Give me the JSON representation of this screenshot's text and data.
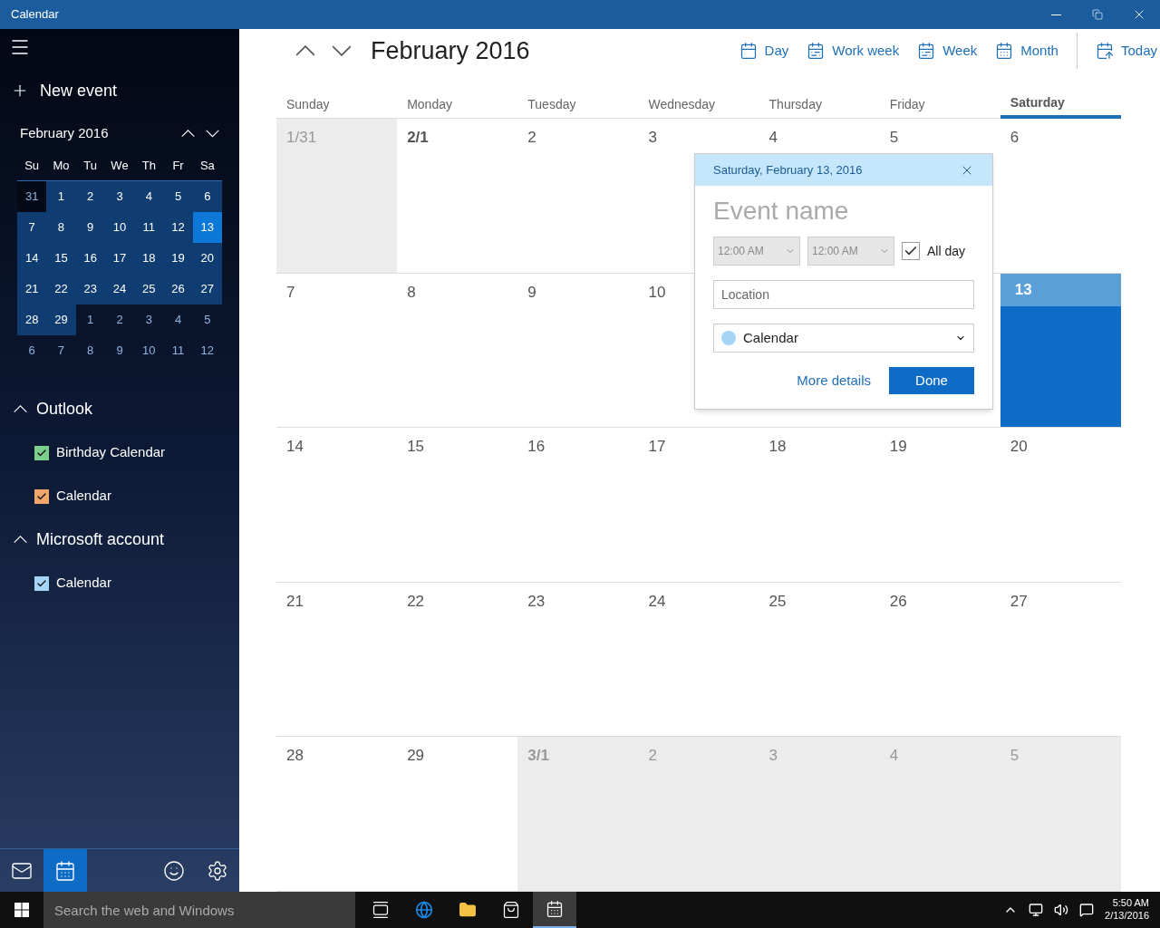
{
  "window": {
    "title": "Calendar"
  },
  "sidebar": {
    "new_event": "New event",
    "mini_calendar": {
      "title": "February 2016",
      "weekdays": [
        "Su",
        "Mo",
        "Tu",
        "We",
        "Th",
        "Fr",
        "Sa"
      ],
      "weeks": [
        [
          {
            "label": "31",
            "in_month": false,
            "selected": false
          },
          {
            "label": "1",
            "in_month": true,
            "selected": false
          },
          {
            "label": "2",
            "in_month": true,
            "selected": false
          },
          {
            "label": "3",
            "in_month": true,
            "selected": false
          },
          {
            "label": "4",
            "in_month": true,
            "selected": false
          },
          {
            "label": "5",
            "in_month": true,
            "selected": false
          },
          {
            "label": "6",
            "in_month": true,
            "selected": false
          }
        ],
        [
          {
            "label": "7",
            "in_month": true,
            "selected": false
          },
          {
            "label": "8",
            "in_month": true,
            "selected": false
          },
          {
            "label": "9",
            "in_month": true,
            "selected": false
          },
          {
            "label": "10",
            "in_month": true,
            "selected": false
          },
          {
            "label": "11",
            "in_month": true,
            "selected": false
          },
          {
            "label": "12",
            "in_month": true,
            "selected": false
          },
          {
            "label": "13",
            "in_month": true,
            "selected": true
          }
        ],
        [
          {
            "label": "14",
            "in_month": true,
            "selected": false
          },
          {
            "label": "15",
            "in_month": true,
            "selected": false
          },
          {
            "label": "16",
            "in_month": true,
            "selected": false
          },
          {
            "label": "17",
            "in_month": true,
            "selected": false
          },
          {
            "label": "18",
            "in_month": true,
            "selected": false
          },
          {
            "label": "19",
            "in_month": true,
            "selected": false
          },
          {
            "label": "20",
            "in_month": true,
            "selected": false
          }
        ],
        [
          {
            "label": "21",
            "in_month": true,
            "selected": false
          },
          {
            "label": "22",
            "in_month": true,
            "selected": false
          },
          {
            "label": "23",
            "in_month": true,
            "selected": false
          },
          {
            "label": "24",
            "in_month": true,
            "selected": false
          },
          {
            "label": "25",
            "in_month": true,
            "selected": false
          },
          {
            "label": "26",
            "in_month": true,
            "selected": false
          },
          {
            "label": "27",
            "in_month": true,
            "selected": false
          }
        ],
        [
          {
            "label": "28",
            "in_month": true,
            "selected": false
          },
          {
            "label": "29",
            "in_month": true,
            "selected": false
          },
          {
            "label": "1",
            "in_month": false,
            "selected": false
          },
          {
            "label": "2",
            "in_month": false,
            "selected": false
          },
          {
            "label": "3",
            "in_month": false,
            "selected": false
          },
          {
            "label": "4",
            "in_month": false,
            "selected": false
          },
          {
            "label": "5",
            "in_month": false,
            "selected": false
          }
        ],
        [
          {
            "label": "6",
            "in_month": false,
            "selected": false
          },
          {
            "label": "7",
            "in_month": false,
            "selected": false
          },
          {
            "label": "8",
            "in_month": false,
            "selected": false
          },
          {
            "label": "9",
            "in_month": false,
            "selected": false
          },
          {
            "label": "10",
            "in_month": false,
            "selected": false
          },
          {
            "label": "11",
            "in_month": false,
            "selected": false
          },
          {
            "label": "12",
            "in_month": false,
            "selected": false
          }
        ]
      ]
    },
    "groups": [
      {
        "name": "Outlook",
        "expanded": true,
        "calendars": [
          {
            "name": "Birthday Calendar",
            "checked": true,
            "color": "#7ccf8a"
          },
          {
            "name": "Calendar",
            "checked": true,
            "color": "#f0a56a"
          }
        ]
      },
      {
        "name": "Microsoft account",
        "expanded": true,
        "calendars": [
          {
            "name": "Calendar",
            "checked": true,
            "color": "#a6d4f7"
          }
        ]
      }
    ],
    "nav": [
      {
        "kind": "mail",
        "selected": false
      },
      {
        "kind": "calendar",
        "selected": true
      },
      {
        "kind": "feedback",
        "selected": false
      },
      {
        "kind": "settings",
        "selected": false
      }
    ]
  },
  "header": {
    "title": "February 2016",
    "views": [
      {
        "kind": "day",
        "label": "Day"
      },
      {
        "kind": "workweek",
        "label": "Work week"
      },
      {
        "kind": "week",
        "label": "Week"
      },
      {
        "kind": "month",
        "label": "Month"
      }
    ],
    "today": "Today"
  },
  "grid": {
    "weekdays": [
      {
        "label": "Sunday",
        "selected": false
      },
      {
        "label": "Monday",
        "selected": false
      },
      {
        "label": "Tuesday",
        "selected": false
      },
      {
        "label": "Wednesday",
        "selected": false
      },
      {
        "label": "Thursday",
        "selected": false
      },
      {
        "label": "Friday",
        "selected": false
      },
      {
        "label": "Saturday",
        "selected": true
      }
    ],
    "weeks": [
      [
        {
          "label": "1/31",
          "in_month": false,
          "selected": false,
          "month_start": false
        },
        {
          "label": "2/1",
          "in_month": true,
          "selected": false,
          "month_start": true
        },
        {
          "label": "2",
          "in_month": true,
          "selected": false,
          "month_start": false
        },
        {
          "label": "3",
          "in_month": true,
          "selected": false,
          "month_start": false
        },
        {
          "label": "4",
          "in_month": true,
          "selected": false,
          "month_start": false
        },
        {
          "label": "5",
          "in_month": true,
          "selected": false,
          "month_start": false
        },
        {
          "label": "6",
          "in_month": true,
          "selected": false,
          "month_start": false
        }
      ],
      [
        {
          "label": "7",
          "in_month": true,
          "selected": false,
          "month_start": false
        },
        {
          "label": "8",
          "in_month": true,
          "selected": false,
          "month_start": false
        },
        {
          "label": "9",
          "in_month": true,
          "selected": false,
          "month_start": false
        },
        {
          "label": "10",
          "in_month": true,
          "selected": false,
          "month_start": false
        },
        {
          "in_month": true,
          "selected": false
        },
        {
          "in_month": true,
          "selected": false
        },
        {
          "label": "13",
          "in_month": true,
          "selected": true,
          "month_start": false
        }
      ],
      [
        {
          "label": "14",
          "in_month": true,
          "selected": false,
          "month_start": false
        },
        {
          "label": "15",
          "in_month": true,
          "selected": false,
          "month_start": false
        },
        {
          "label": "16",
          "in_month": true,
          "selected": false,
          "month_start": false
        },
        {
          "label": "17",
          "in_month": true,
          "selected": false,
          "month_start": false
        },
        {
          "label": "18",
          "in_month": true,
          "selected": false,
          "month_start": false
        },
        {
          "label": "19",
          "in_month": true,
          "selected": false,
          "month_start": false
        },
        {
          "label": "20",
          "in_month": true,
          "selected": false,
          "month_start": false
        }
      ],
      [
        {
          "label": "21",
          "in_month": true,
          "selected": false,
          "month_start": false
        },
        {
          "label": "22",
          "in_month": true,
          "selected": false,
          "month_start": false
        },
        {
          "label": "23",
          "in_month": true,
          "selected": false,
          "month_start": false
        },
        {
          "label": "24",
          "in_month": true,
          "selected": false,
          "month_start": false
        },
        {
          "label": "25",
          "in_month": true,
          "selected": false,
          "month_start": false
        },
        {
          "label": "26",
          "in_month": true,
          "selected": false,
          "month_start": false
        },
        {
          "label": "27",
          "in_month": true,
          "selected": false,
          "month_start": false
        }
      ],
      [
        {
          "label": "28",
          "in_month": true,
          "selected": false,
          "month_start": false
        },
        {
          "label": "29",
          "in_month": true,
          "selected": false,
          "month_start": false
        },
        {
          "label": "3/1",
          "in_month": false,
          "selected": false,
          "month_start": true
        },
        {
          "label": "2",
          "in_month": false,
          "selected": false,
          "month_start": false
        },
        {
          "label": "3",
          "in_month": false,
          "selected": false,
          "month_start": false
        },
        {
          "label": "4",
          "in_month": false,
          "selected": false,
          "month_start": false
        },
        {
          "label": "5",
          "in_month": false,
          "selected": false,
          "month_start": false
        }
      ]
    ]
  },
  "popup": {
    "date": "Saturday, February 13, 2016",
    "event_placeholder": "Event name",
    "start_time": "12:00 AM",
    "end_time": "12:00 AM",
    "times_disabled": true,
    "all_day": {
      "label": "All day",
      "checked": true
    },
    "location_placeholder": "Location",
    "calendar": {
      "label": "Calendar",
      "color": "#a6d4f7"
    },
    "more_details": "More details",
    "done": "Done"
  },
  "taskbar": {
    "search_placeholder": "Search the web and Windows",
    "apps": [
      {
        "kind": "taskview",
        "selected": false
      },
      {
        "kind": "browser",
        "selected": false
      },
      {
        "kind": "files",
        "selected": false
      },
      {
        "kind": "store",
        "selected": false
      },
      {
        "kind": "calendar",
        "selected": true
      }
    ],
    "time": "5:50 AM",
    "date": "2/13/2016"
  }
}
